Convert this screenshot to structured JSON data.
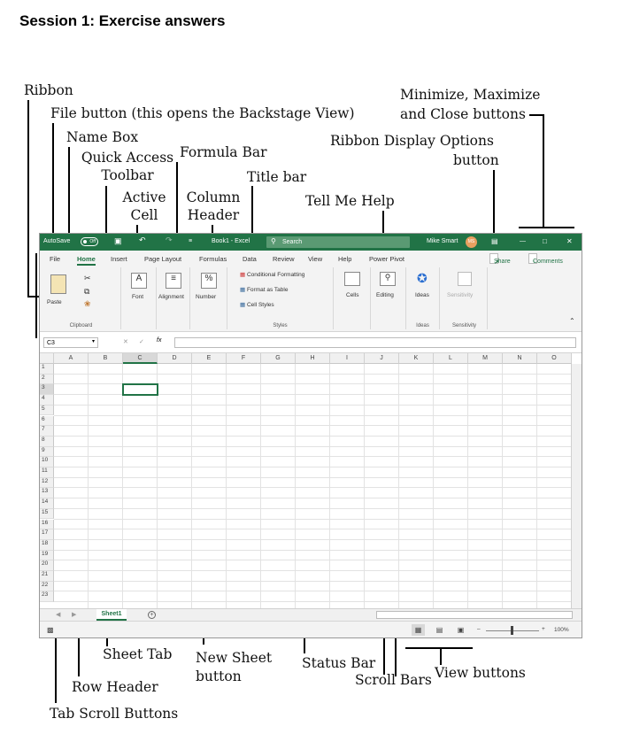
{
  "heading": "Session 1: Exercise answers",
  "labels": {
    "ribbon": "Ribbon",
    "file_button": "File button (this opens the Backstage View)",
    "name_box": "Name Box",
    "quick_access_1": "Quick Access",
    "quick_access_2": "Toolbar",
    "formula_bar": "Formula Bar",
    "title_bar": "Title bar",
    "active_cell_1": "Active",
    "active_cell_2": "Cell",
    "column_header_1": "Column",
    "column_header_2": "Header",
    "tell_me": "Tell Me Help",
    "min_max_1": "Minimize, Maximize",
    "min_max_2": "and Close buttons",
    "ribbon_display_1": "Ribbon Display Options",
    "ribbon_display_2": "button",
    "sheet_tab": "Sheet Tab",
    "new_sheet_1": "New Sheet",
    "new_sheet_2": "button",
    "status_bar": "Status Bar",
    "scroll_bars": "Scroll Bars",
    "view_buttons": "View buttons",
    "row_header": "Row Header",
    "tab_scroll": "Tab Scroll Buttons"
  },
  "excel": {
    "autosave": "AutoSave",
    "autosave_state": "Off",
    "title": "Book1 - Excel",
    "search": "Search",
    "user": "Mike Smart",
    "initials": "MS",
    "tabs": [
      "File",
      "Home",
      "Insert",
      "Page Layout",
      "Formulas",
      "Data",
      "Review",
      "View",
      "Help",
      "Power Pivot"
    ],
    "share": "Share",
    "comments": "Comments",
    "ribbon": {
      "paste": "Paste",
      "clipboard": "Clipboard",
      "font": "Font",
      "alignment": "Alignment",
      "number": "Number",
      "cond_format": "Conditional Formatting",
      "format_table": "Format as Table",
      "cell_styles": "Cell Styles",
      "styles": "Styles",
      "cells": "Cells",
      "editing": "Editing",
      "ideas": "Ideas",
      "ideas_group": "Ideas",
      "sensitivity": "Sensitivity",
      "sensitivity_group": "Sensitivity"
    },
    "name_box": "C3",
    "fx": "fx",
    "columns": [
      "A",
      "B",
      "C",
      "D",
      "E",
      "F",
      "G",
      "H",
      "I",
      "J",
      "K",
      "L",
      "M",
      "N",
      "O"
    ],
    "rows": [
      "1",
      "2",
      "3",
      "4",
      "5",
      "6",
      "7",
      "8",
      "9",
      "10",
      "11",
      "12",
      "13",
      "14",
      "15",
      "16",
      "17",
      "18",
      "19",
      "20",
      "21",
      "22",
      "23"
    ],
    "sheet": "Sheet1",
    "zoom": "100%"
  },
  "colors": {
    "excel_green": "#217346",
    "avatar": "#e8a060"
  }
}
